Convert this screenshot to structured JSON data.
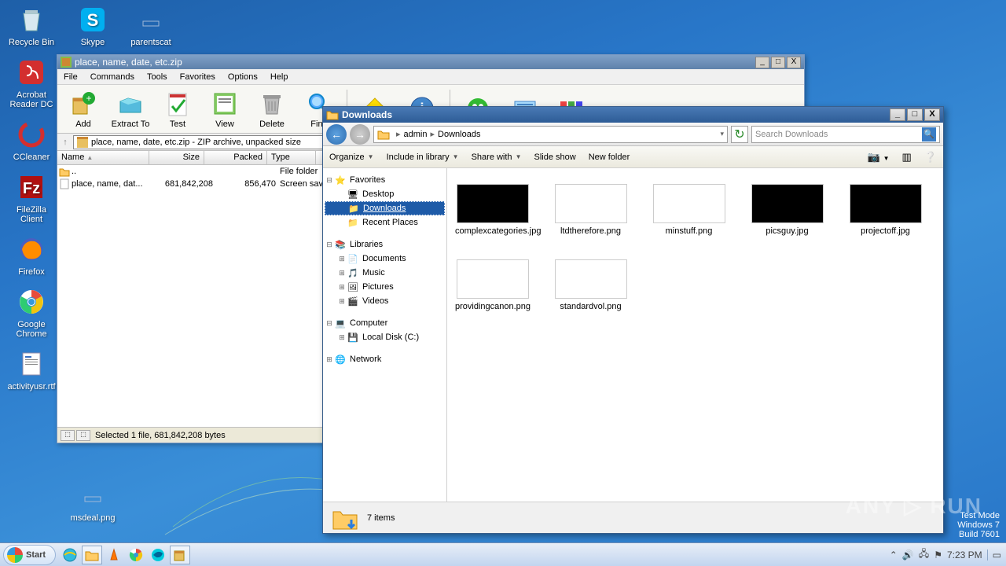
{
  "desktop": {
    "icons": [
      {
        "label": "Recycle Bin"
      },
      {
        "label": "Acrobat Reader DC"
      },
      {
        "label": "CCleaner"
      },
      {
        "label": "FileZilla Client"
      },
      {
        "label": "Firefox"
      },
      {
        "label": "Google Chrome"
      },
      {
        "label": "activityusr.rtf"
      }
    ],
    "icons2": [
      {
        "label": "Skype"
      },
      {
        "label": "parentscat"
      },
      {
        "label": "msdeal.png"
      }
    ]
  },
  "winrar": {
    "title": "place, name, date, etc.zip",
    "menus": [
      "File",
      "Commands",
      "Tools",
      "Favorites",
      "Options",
      "Help"
    ],
    "tools": [
      "Add",
      "Extract To",
      "Test",
      "View",
      "Delete",
      "Find"
    ],
    "path": "place, name, date, etc.zip - ZIP archive, unpacked size",
    "headers": {
      "name": "Name",
      "size": "Size",
      "packed": "Packed",
      "type": "Type"
    },
    "rows": [
      {
        "name": "..",
        "size": "",
        "packed": "",
        "type": "File folder"
      },
      {
        "name": "place, name, dat...",
        "size": "681,842,208",
        "packed": "856,470",
        "type": "Screen sav"
      }
    ],
    "status": "Selected 1 file, 681,842,208 bytes"
  },
  "explorer": {
    "title": "Downloads",
    "crumbs": [
      "admin",
      "Downloads"
    ],
    "search_placeholder": "Search Downloads",
    "cmds": {
      "organize": "Organize",
      "include": "Include in library",
      "share": "Share with",
      "slide": "Slide show",
      "newf": "New folder"
    },
    "nav": {
      "favorites": "Favorites",
      "desktop": "Desktop",
      "downloads": "Downloads",
      "recent": "Recent Places",
      "libraries": "Libraries",
      "documents": "Documents",
      "music": "Music",
      "pictures": "Pictures",
      "videos": "Videos",
      "computer": "Computer",
      "localdisk": "Local Disk (C:)",
      "network": "Network"
    },
    "files": [
      {
        "name": "complexcategories.jpg",
        "dark": true
      },
      {
        "name": "ltdtherefore.png",
        "dark": false
      },
      {
        "name": "minstuff.png",
        "dark": false
      },
      {
        "name": "picsguy.jpg",
        "dark": true
      },
      {
        "name": "projectoff.jpg",
        "dark": true
      },
      {
        "name": "providingcanon.png",
        "dark": false
      },
      {
        "name": "standardvol.png",
        "dark": false
      }
    ],
    "status": "7 items"
  },
  "taskbar": {
    "start": "Start",
    "time": "7:23 PM"
  },
  "watermark": {
    "l1": "Test Mode",
    "l2": "Windows 7",
    "l3": "Build 7601"
  },
  "logo": "ANY ▷ RUN"
}
